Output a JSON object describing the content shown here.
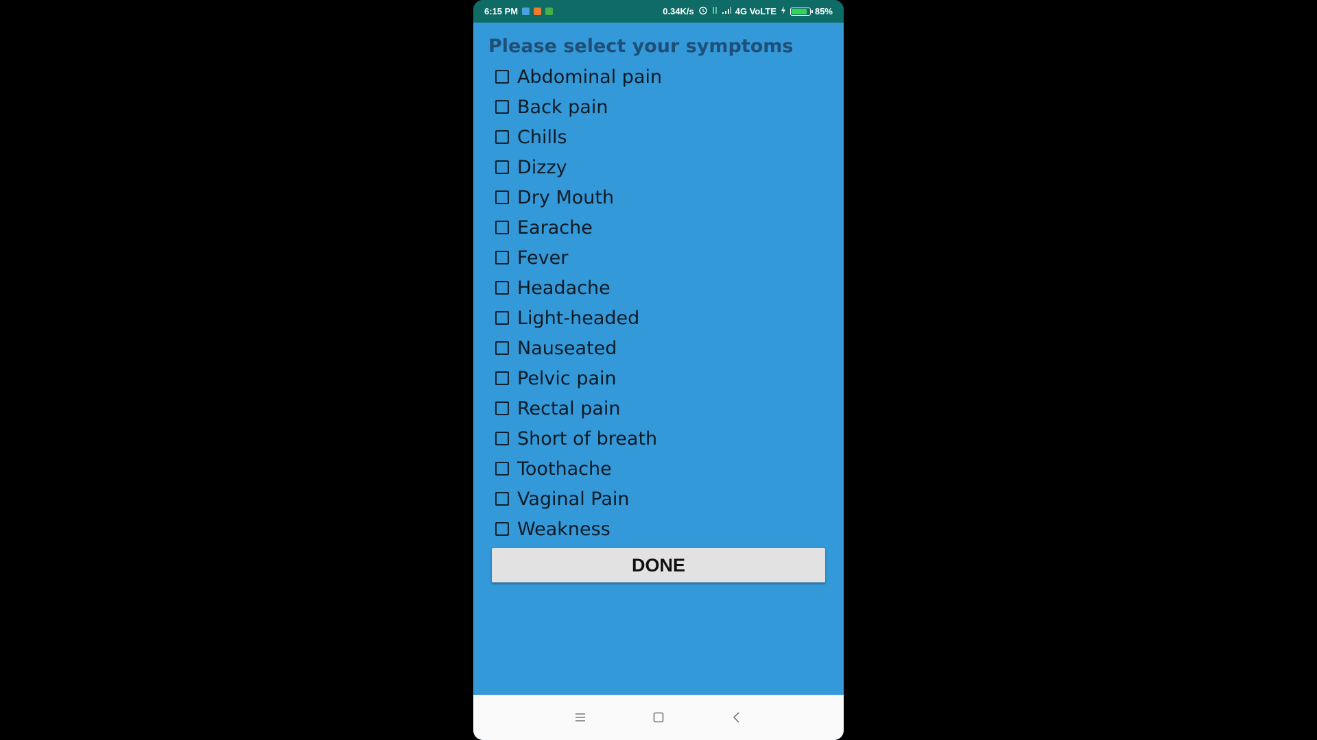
{
  "status_bar": {
    "time": "6:15 PM",
    "net_speed": "0.34K/s",
    "network": "4G VoLTE",
    "battery_text": "85%",
    "battery_level": 0.85,
    "icons": [
      "notification-blue-icon",
      "notification-orange-icon",
      "notification-green-icon",
      "alarm-icon",
      "data-arrows-icon",
      "signal-icon",
      "charging-icon",
      "battery-icon"
    ]
  },
  "title": "Please select your symptoms",
  "symptoms": [
    {
      "label": "Abdominal pain",
      "checked": false
    },
    {
      "label": "Back pain",
      "checked": false
    },
    {
      "label": "Chills",
      "checked": false
    },
    {
      "label": "Dizzy",
      "checked": false
    },
    {
      "label": "Dry Mouth",
      "checked": false
    },
    {
      "label": "Earache",
      "checked": false
    },
    {
      "label": "Fever",
      "checked": false
    },
    {
      "label": "Headache",
      "checked": false
    },
    {
      "label": "Light-headed",
      "checked": false
    },
    {
      "label": "Nauseated",
      "checked": false
    },
    {
      "label": "Pelvic pain",
      "checked": false
    },
    {
      "label": "Rectal pain",
      "checked": false
    },
    {
      "label": "Short of breath",
      "checked": false
    },
    {
      "label": "Toothache",
      "checked": false
    },
    {
      "label": "Vaginal Pain",
      "checked": false
    },
    {
      "label": "Weakness",
      "checked": false
    }
  ],
  "done_label": "DONE",
  "nav_bar": {
    "icons": [
      "menu-icon",
      "home-icon",
      "back-icon"
    ]
  },
  "colors": {
    "background": "#3399d9",
    "status_bar": "#0f6b66",
    "title": "#1f4f78",
    "button": "#e2e2e2",
    "screen_outside": "#000000"
  }
}
